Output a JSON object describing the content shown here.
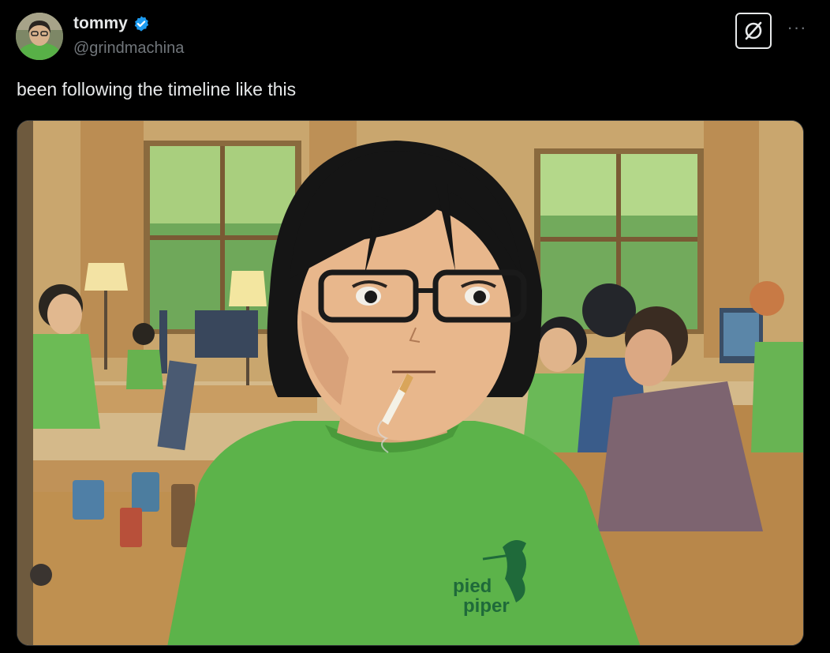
{
  "user": {
    "display_name": "tommy",
    "handle": "@grindmachina",
    "verified": true,
    "verified_color": "#1d9bf0"
  },
  "tweet": {
    "text": "been following the timeline like this"
  },
  "header_actions": {
    "grok_icon": "grok-icon",
    "more_icon": "more-icon",
    "more_glyph": "···"
  },
  "media": {
    "shirt_logo_line1": "pied",
    "shirt_logo_line2": "piper"
  },
  "colors": {
    "background": "#000000",
    "text": "#e7e9ea",
    "secondary": "#71767b",
    "shirt_green": "#5cb34a",
    "logo_green": "#1f6a3a"
  }
}
